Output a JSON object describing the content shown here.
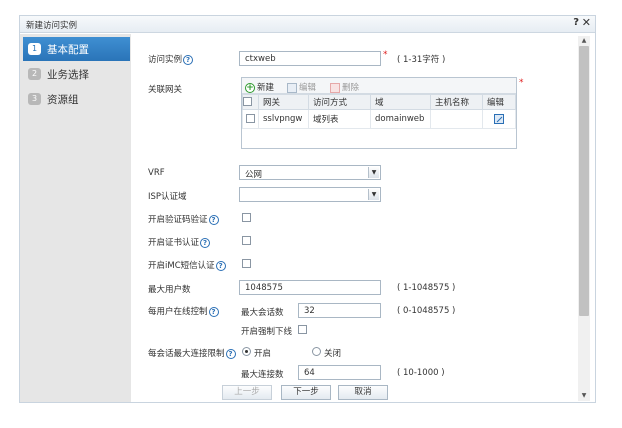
{
  "dialog": {
    "title": "新建访问实例",
    "help_label": "?",
    "close_label": "✕"
  },
  "steps": [
    {
      "num": "1",
      "label": "基本配置",
      "active": true
    },
    {
      "num": "2",
      "label": "业务选择",
      "active": false
    },
    {
      "num": "3",
      "label": "资源组",
      "active": false
    }
  ],
  "form": {
    "instance_label": "访问实例",
    "instance_value": "ctxweb",
    "instance_hint": "( 1-31字符 )",
    "gateway_label": "关联网关",
    "gateway_toolbar": {
      "add": "新建",
      "edit": "编辑",
      "delete": "删除"
    },
    "gateway_columns": [
      "网关",
      "访问方式",
      "域",
      "主机名称",
      "编辑"
    ],
    "gateway_rows": [
      {
        "gateway": "sslvpngw",
        "method": "域列表",
        "domain": "domainweb",
        "host": ""
      }
    ],
    "vrf_label": "VRF",
    "vrf_value": "公网",
    "isp_label": "ISP认证域",
    "isp_value": "",
    "verify_code_label": "开启验证码验证",
    "cert_auth_label": "开启证书认证",
    "imc_sms_label": "开启iMC短信认证",
    "max_users_label": "最大用户数",
    "max_users_value": "1048575",
    "max_users_hint": "( 1-1048575 )",
    "per_user_label": "每用户在线控制",
    "max_sessions_label": "最大会话数",
    "max_sessions_value": "32",
    "max_sessions_hint": "( 0-1048575 )",
    "force_offline_label": "开启强制下线",
    "conn_limit_label": "每会话最大连接限制",
    "radio_on_label": "开启",
    "radio_off_label": "关闭",
    "max_conn_label": "最大连接数",
    "max_conn_value": "64",
    "max_conn_hint": "( 10-1000 )"
  },
  "footer": {
    "prev_label": "上一步",
    "next_label": "下一步",
    "cancel_label": "取消"
  },
  "colors": {
    "accent": "#2a74b8",
    "required": "#e02020"
  }
}
